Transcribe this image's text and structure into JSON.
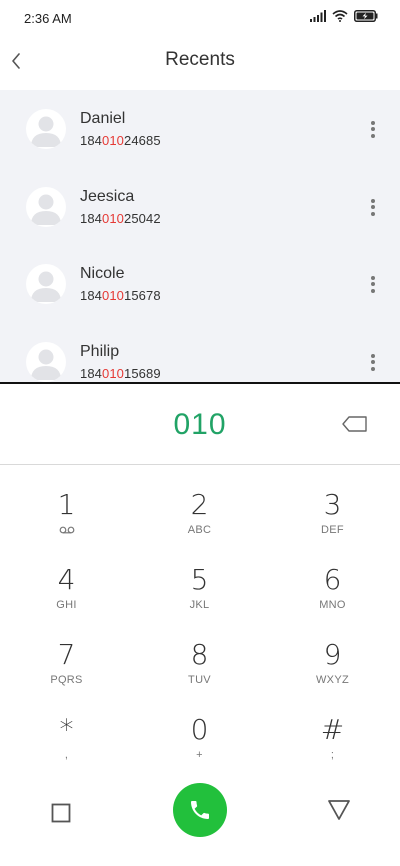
{
  "status_bar": {
    "time": "2:36 AM"
  },
  "header": {
    "title": "Recents"
  },
  "recents": [
    {
      "name": "Daniel",
      "number_prefix": "184",
      "number_match": "010",
      "number_suffix": "24685"
    },
    {
      "name": "Jeesica",
      "number_prefix": "184",
      "number_match": "010",
      "number_suffix": "25042"
    },
    {
      "name": "Nicole",
      "number_prefix": "184",
      "number_match": "010",
      "number_suffix": "15678"
    },
    {
      "name": "Philip",
      "number_prefix": "184",
      "number_match": "010",
      "number_suffix": "15689"
    }
  ],
  "dialer": {
    "input": "010"
  },
  "keypad": [
    {
      "digit": "1",
      "letters": ""
    },
    {
      "digit": "2",
      "letters": "ABC"
    },
    {
      "digit": "3",
      "letters": "DEF"
    },
    {
      "digit": "4",
      "letters": "GHI"
    },
    {
      "digit": "5",
      "letters": "JKL"
    },
    {
      "digit": "6",
      "letters": "MNO"
    },
    {
      "digit": "7",
      "letters": "PQRS"
    },
    {
      "digit": "8",
      "letters": "TUV"
    },
    {
      "digit": "9",
      "letters": "WXYZ"
    },
    {
      "digit": "*",
      "letters": ","
    },
    {
      "digit": "0",
      "letters": "+"
    },
    {
      "digit": "#",
      "letters": ";"
    }
  ],
  "colors": {
    "accent_green": "#21a366",
    "call_button": "#22c03c",
    "match_highlight": "#e53935",
    "list_background": "#f2f3f7"
  },
  "icons": {
    "back": "chevron-left-icon",
    "signal": "signal-icon",
    "wifi": "wifi-icon",
    "battery": "battery-charging-icon",
    "more": "more-vertical-icon",
    "backspace": "backspace-icon",
    "voicemail": "voicemail-icon",
    "call": "phone-icon",
    "square": "square-icon",
    "triangle": "triangle-down-icon"
  }
}
